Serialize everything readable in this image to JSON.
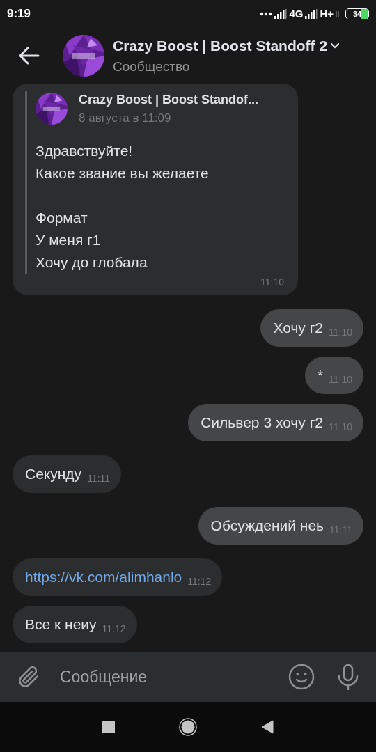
{
  "status_bar": {
    "time": "9:19",
    "network_1": "4G",
    "network_2": "H+",
    "battery": "34"
  },
  "header": {
    "title": "Crazy Boost | Boost Standoff 2",
    "subtitle": "Сообщество"
  },
  "messages": [
    {
      "kind": "forwarded",
      "outgoing": false,
      "author": "Crazy Boost | Boost Standof...",
      "date": "8 августа в 11:09",
      "paragraphs": [
        [
          "Здравствуйте!",
          "Какое звание вы желаете"
        ],
        [
          "Формат",
          "У меня г1",
          "Хочу до глобала"
        ]
      ],
      "time": "11:10"
    },
    {
      "kind": "text",
      "outgoing": true,
      "text": "Хочу г2",
      "time": "11:10"
    },
    {
      "kind": "text",
      "outgoing": true,
      "text": "*",
      "time": "11:10"
    },
    {
      "kind": "text",
      "outgoing": true,
      "text": "Сильвер 3 хочу г2",
      "time": "11:10"
    },
    {
      "kind": "text",
      "outgoing": false,
      "text": "Секунду",
      "time": "11:11"
    },
    {
      "kind": "text",
      "outgoing": true,
      "text": "Обсуждений неь",
      "time": "11:11"
    },
    {
      "kind": "link",
      "outgoing": false,
      "text": "https://vk.com/alimhanlo",
      "time": "11:12"
    },
    {
      "kind": "text",
      "outgoing": false,
      "text": "Все к неиу",
      "time": "11:12"
    }
  ],
  "composer": {
    "placeholder": "Сообщение"
  }
}
